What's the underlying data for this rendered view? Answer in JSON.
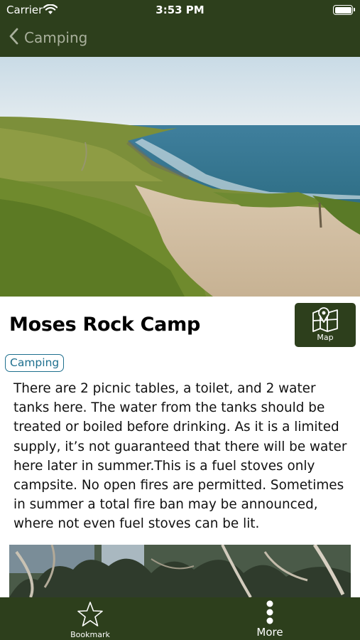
{
  "status_bar": {
    "carrier": "Carrier",
    "time": "3:53 PM",
    "wifi_icon": "wifi-icon",
    "battery_icon": "battery-icon"
  },
  "nav": {
    "back_label": "Camping",
    "back_icon": "chevron-left-icon"
  },
  "hero": {
    "description_icon": "coastal-landscape-photo"
  },
  "detail": {
    "title": "Moses Rock Camp",
    "map_button": {
      "label": "Map",
      "icon": "map-pin-icon"
    },
    "category_tag": "Camping",
    "description": "There are 2 picnic tables, a toilet, and 2 water tanks here. The water from the tanks should be treated or boiled before drinking. As it is a limited supply, it’s not guaranteed that there will be water here later in summer.This is a fuel stoves only campsite. No open fires are permitted. Sometimes in summer a total fire ban may be announced, where not even fuel stoves can be lit."
  },
  "tab_bar": {
    "bookmark": {
      "label": "Bookmark",
      "icon": "star-icon"
    },
    "more": {
      "label": "More",
      "icon": "more-vertical-icon"
    }
  },
  "colors": {
    "bar_green": "#2d3f1c",
    "tag_blue": "#1e6f8e",
    "back_label_gray": "#a9b09c"
  }
}
